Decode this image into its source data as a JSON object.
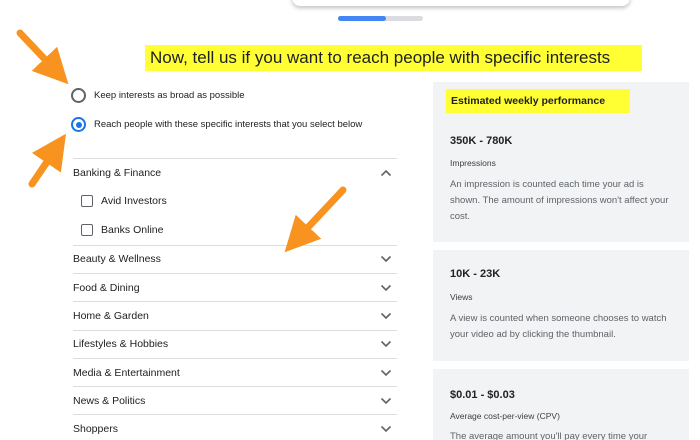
{
  "headline": "Now, tell us if you want to reach people with specific interests",
  "progress": {
    "fraction": 0.57
  },
  "radio_options": [
    {
      "label": "Keep interests as broad as possible",
      "selected": false
    },
    {
      "label": "Reach people with these specific interests that you select below",
      "selected": true
    }
  ],
  "categories": [
    {
      "label": "Banking & Finance",
      "expanded": true,
      "subitems": [
        {
          "label": "Avid Investors",
          "checked": false
        },
        {
          "label": "Banks Online",
          "checked": false
        }
      ]
    },
    {
      "label": "Beauty & Wellness",
      "expanded": false
    },
    {
      "label": "Food & Dining",
      "expanded": false
    },
    {
      "label": "Home & Garden",
      "expanded": false
    },
    {
      "label": "Lifestyles & Hobbies",
      "expanded": false
    },
    {
      "label": "Media & Entertainment",
      "expanded": false
    },
    {
      "label": "News & Politics",
      "expanded": false
    },
    {
      "label": "Shoppers",
      "expanded": false
    }
  ],
  "performance": {
    "title": "Estimated weekly performance",
    "metrics": [
      {
        "value": "350K - 780K",
        "name": "Impressions",
        "description": "An impression is counted each time your ad is shown. The amount of impressions won't affect your cost."
      },
      {
        "value": "10K - 23K",
        "name": "Views",
        "description": "A view is counted when someone chooses to watch your video ad by clicking the thumbnail."
      },
      {
        "value": "$0.01 - $0.03",
        "name": "Average cost-per-view (CPV)",
        "description": "The average amount you'll pay every time your"
      }
    ]
  },
  "colors": {
    "highlight": "#ffff33",
    "accent": "#1a73e8",
    "annotation_arrow": "#f7931e",
    "panel_bg": "#f1f3f4"
  },
  "icons": {
    "category_expanded": "chevron-up-icon",
    "category_collapsed": "chevron-down-icon",
    "annotation": "arrow-icon"
  }
}
